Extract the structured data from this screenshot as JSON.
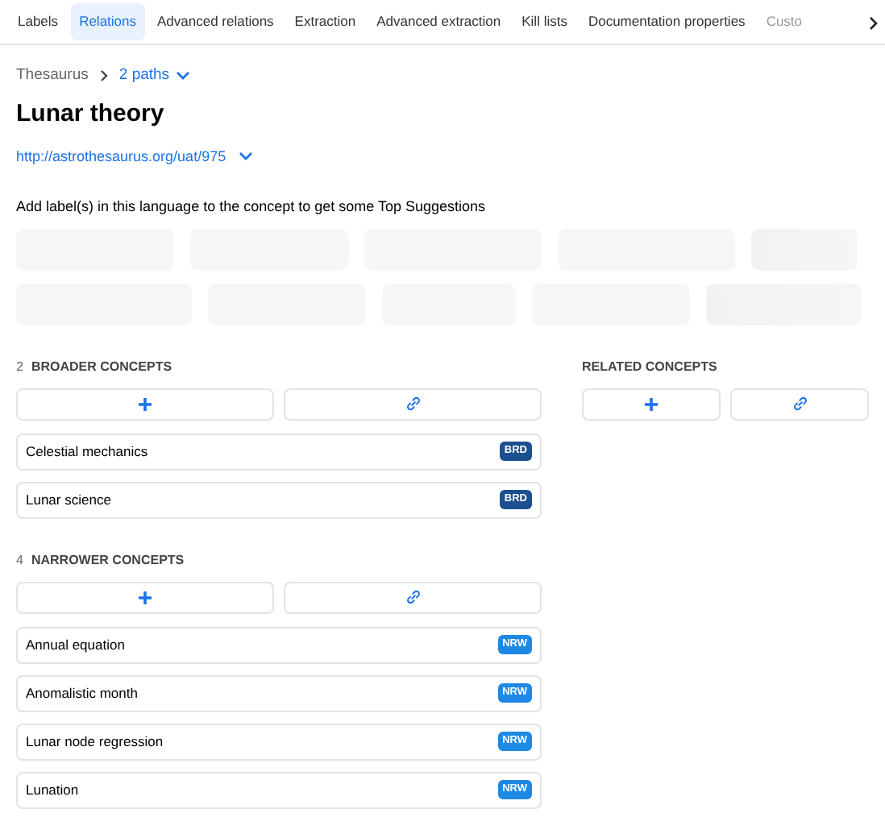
{
  "tabs": [
    {
      "label": "Labels",
      "selected": false
    },
    {
      "label": "Relations",
      "selected": true
    },
    {
      "label": "Advanced relations",
      "selected": false
    },
    {
      "label": "Extraction",
      "selected": false
    },
    {
      "label": "Advanced extraction",
      "selected": false
    },
    {
      "label": "Kill lists",
      "selected": false
    },
    {
      "label": "Documentation properties",
      "selected": false
    },
    {
      "label": "Custo",
      "selected": false
    }
  ],
  "breadcrumb": {
    "root": "Thesaurus",
    "paths": "2 paths"
  },
  "title": "Lunar theory",
  "uri": "http://astrothesaurus.org/uat/975",
  "suggestions_hint": "Add label(s) in this language to the concept to get some Top Suggestions",
  "sections": [
    {
      "kind": "broader",
      "count": "2",
      "heading": "BROADER CONCEPTS",
      "items": [
        {
          "label": "Celestial mechanics",
          "badge": "BRD"
        },
        {
          "label": "Lunar science",
          "badge": "BRD"
        }
      ]
    },
    {
      "kind": "narrower",
      "count": "4",
      "heading": "NARROWER CONCEPTS",
      "items": [
        {
          "label": "Annual equation",
          "badge": "NRW"
        },
        {
          "label": "Anomalistic month",
          "badge": "NRW"
        },
        {
          "label": "Lunar node regression",
          "badge": "NRW"
        },
        {
          "label": "Lunation",
          "badge": "NRW"
        }
      ]
    }
  ],
  "related": {
    "heading": "RELATED CONCEPTS"
  }
}
